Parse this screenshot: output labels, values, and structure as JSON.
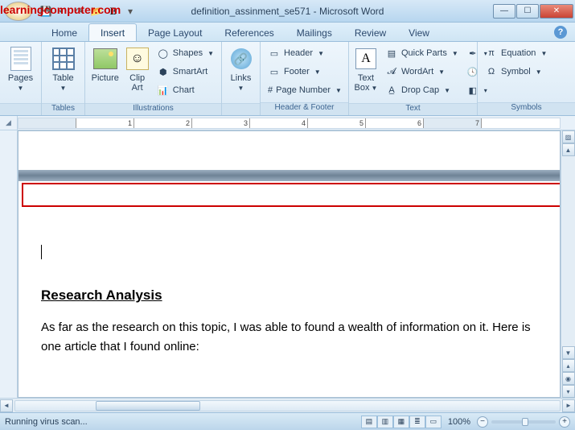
{
  "watermark": "learningcomputer.com",
  "title": "definition_assinment_se571 - Microsoft Word",
  "tabs": [
    "Home",
    "Insert",
    "Page Layout",
    "References",
    "Mailings",
    "Review",
    "View"
  ],
  "active_tab_index": 1,
  "ribbon": {
    "pages": {
      "label": "Pages",
      "group": ""
    },
    "tables": {
      "label": "Table",
      "group": "Tables"
    },
    "illustrations": {
      "picture": "Picture",
      "clipart_l1": "Clip",
      "clipart_l2": "Art",
      "shapes": "Shapes",
      "smartart": "SmartArt",
      "chart": "Chart",
      "group": "Illustrations"
    },
    "links": {
      "label": "Links",
      "group": ""
    },
    "headerfooter": {
      "header": "Header",
      "footer": "Footer",
      "pagenum": "Page Number",
      "group": "Header & Footer"
    },
    "text": {
      "textbox_l1": "Text",
      "textbox_l2": "Box",
      "quickparts": "Quick Parts",
      "wordart": "WordArt",
      "dropcap": "Drop Cap",
      "group": "Text"
    },
    "symbols": {
      "equation": "Equation",
      "symbol": "Symbol",
      "group": "Symbols"
    }
  },
  "ruler_numbers": [
    "1",
    "2",
    "3",
    "4",
    "5",
    "6",
    "7"
  ],
  "document": {
    "heading": "Research Analysis",
    "body": "As far as the research on this topic, I was able to found a wealth of information on it. Here is one article that I found online:"
  },
  "statusbar": {
    "left": "Running virus scan...",
    "zoom": "100%"
  }
}
